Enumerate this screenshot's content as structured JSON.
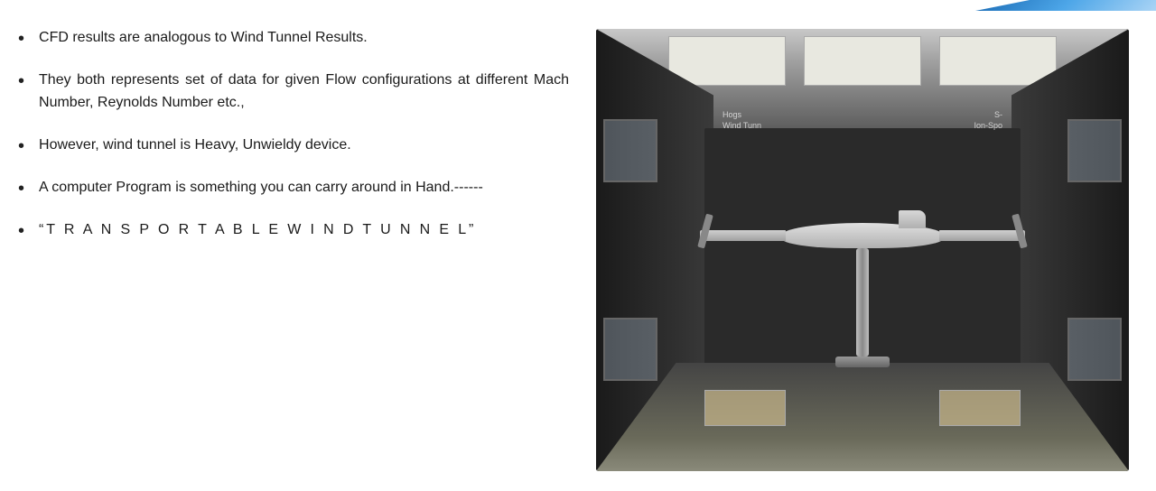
{
  "topbar": {
    "color": "#1a6bb5"
  },
  "bullets": [
    {
      "id": "bullet-1",
      "text": "CFD results are analogous to Wind Tunnel Results."
    },
    {
      "id": "bullet-2",
      "text": "They both represents set of data for given Flow configurations at different Mach Number, Reynolds Number etc.,"
    },
    {
      "id": "bullet-3",
      "text": "However, wind tunnel is  Heavy, Unwieldy device."
    },
    {
      "id": "bullet-4",
      "text": "A computer Program is something you can carry around in Hand.------"
    },
    {
      "id": "bullet-5",
      "text": "“T R A N S P O R T A B L E   W I N D   T U N N E L”"
    }
  ],
  "image": {
    "alt": "Wind tunnel interior with aircraft model on stand",
    "caption": "Wind Tunnel"
  }
}
